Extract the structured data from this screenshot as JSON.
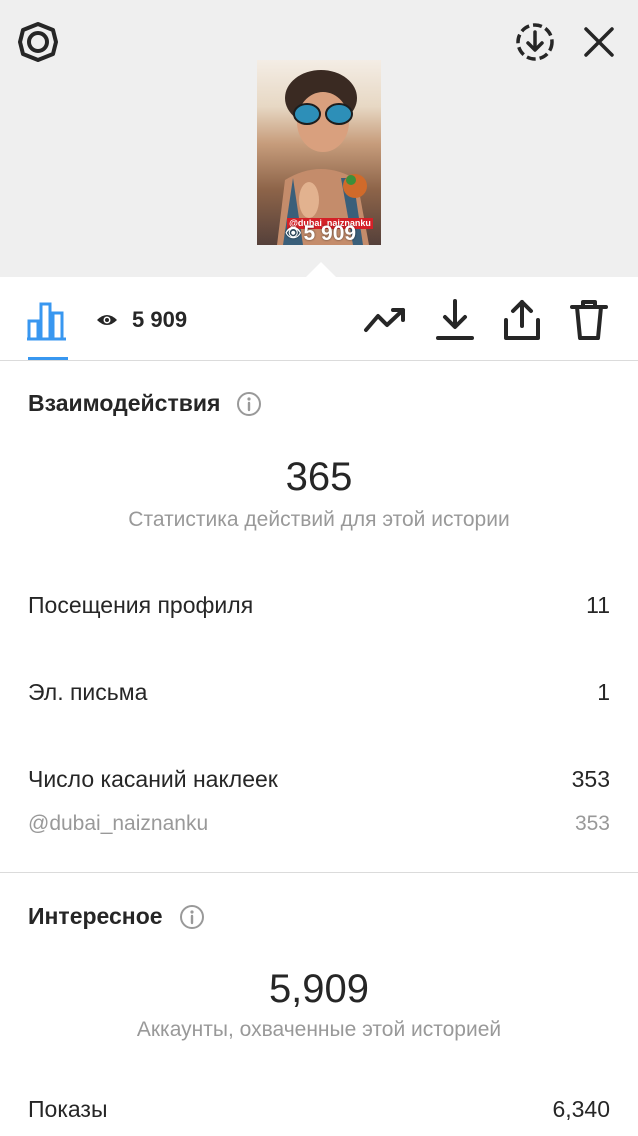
{
  "top_bar": {
    "icons": [
      "settings-icon",
      "download-circle-icon",
      "close-icon"
    ]
  },
  "story_thumbnail": {
    "tag": "@dubai_naiznanku",
    "views": "5 909"
  },
  "toolbar": {
    "views_count": "5 909",
    "icons": [
      "insights-bar-chart-icon",
      "eye-icon",
      "trend-icon",
      "download-icon",
      "share-icon",
      "trash-icon"
    ],
    "accent_color": "#3897f0"
  },
  "interactions": {
    "title": "Взаимодействия",
    "total": "365",
    "description": "Статистика действий для этой истории",
    "rows": [
      {
        "label": "Посещения профиля",
        "value": "11"
      },
      {
        "label": "Эл. письма",
        "value": "1"
      },
      {
        "label": "Число касаний наклеек",
        "value": "353"
      }
    ],
    "sub_row": {
      "label": "@dubai_naiznanku",
      "value": "353"
    }
  },
  "discovery": {
    "title": "Интересное",
    "total": "5,909",
    "description": "Аккаунты, охваченные этой историей",
    "rows": [
      {
        "label": "Показы",
        "value": "6,340"
      }
    ]
  }
}
